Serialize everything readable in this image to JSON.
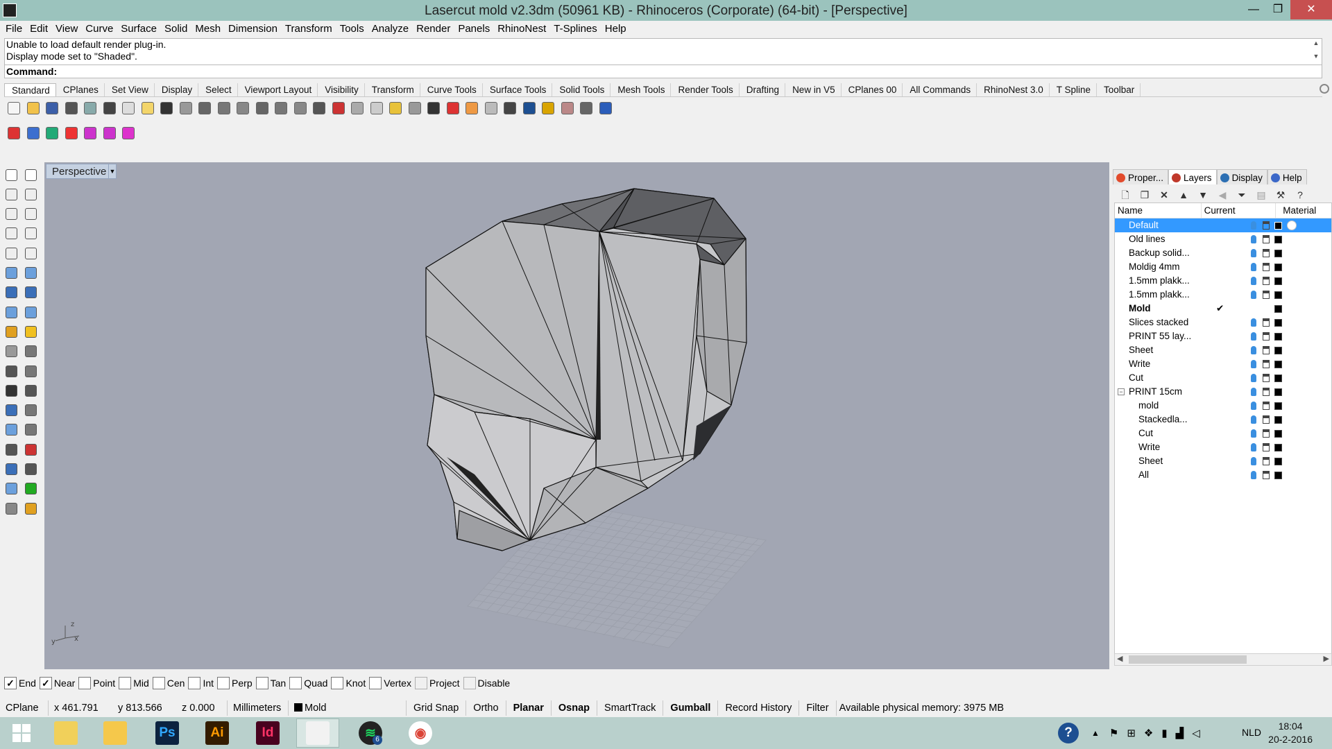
{
  "window": {
    "title": "Lasercut mold v2.3dm (50961 KB) - Rhinoceros (Corporate) (64-bit) - [Perspective]",
    "minimize": "—",
    "maximize": "❐",
    "close": "✕"
  },
  "menu": [
    "File",
    "Edit",
    "View",
    "Curve",
    "Surface",
    "Solid",
    "Mesh",
    "Dimension",
    "Transform",
    "Tools",
    "Analyze",
    "Render",
    "Panels",
    "RhinoNest",
    "T-Splines",
    "Help"
  ],
  "command": {
    "history": [
      "Unable to load default render plug-in.",
      "Display mode set to \"Shaded\"."
    ],
    "prompt": "Command:"
  },
  "toolbar_tabs": [
    "Standard",
    "CPlanes",
    "Set View",
    "Display",
    "Select",
    "Viewport Layout",
    "Visibility",
    "Transform",
    "Curve Tools",
    "Surface Tools",
    "Solid Tools",
    "Mesh Tools",
    "Render Tools",
    "Drafting",
    "New in V5",
    "CPlanes 00",
    "All Commands",
    "RhinoNest 3.0",
    "T Spline",
    "Toolbar"
  ],
  "standard_icons": [
    "new-file-icon",
    "open-icon",
    "save-icon",
    "print-icon",
    "import-icon",
    "cut-icon",
    "copy-icon",
    "paste-icon",
    "undo-icon",
    "pan-icon",
    "rotate-view-icon",
    "zoom-icon",
    "zoom-window-icon",
    "zoom-extents-icon",
    "zoom-selected-icon",
    "undo-view-icon",
    "four-viewports-icon",
    "car-icon",
    "hide-icon",
    "show-icon",
    "points-icon",
    "light-icon",
    "lock-icon",
    "layer-icon",
    "color-wheel-icon",
    "sphere-icon",
    "render-sphere-icon",
    "render-blue-icon",
    "dimension-icon",
    "gear-options-icon",
    "grid-snap-icon",
    "help-icon"
  ],
  "tspline_icons": [
    "gumball-icon",
    "sphere-frame-icon",
    "axes-icon",
    "manipulator-icon",
    "tspline-box-icon",
    "tspline-box-2-icon",
    "tspline-box-3-icon"
  ],
  "viewport": {
    "label": "Perspective",
    "axis_labels": {
      "x": "x",
      "y": "y",
      "z": "z"
    }
  },
  "panels": {
    "tabs": [
      "Proper...",
      "Layers",
      "Display",
      "Help"
    ],
    "tab_colors": [
      "#e24b2c",
      "#c0392b",
      "#2c6fb3",
      "#3a67c8"
    ],
    "columns": [
      "Name",
      "Current",
      "Material"
    ],
    "layers": [
      {
        "name": "Default",
        "selected": true
      },
      {
        "name": "Old lines"
      },
      {
        "name": "Backup solid..."
      },
      {
        "name": "Moldig 4mm"
      },
      {
        "name": "1.5mm plakk..."
      },
      {
        "name": "1.5mm plakk..."
      },
      {
        "name": "Mold",
        "current": true,
        "current_mark": "✔"
      },
      {
        "name": "Slices stacked"
      },
      {
        "name": "PRINT 55 lay..."
      },
      {
        "name": "Sheet"
      },
      {
        "name": "Write"
      },
      {
        "name": "Cut"
      },
      {
        "name": "PRINT 15cm",
        "expander": "−"
      },
      {
        "name": "mold",
        "child": true
      },
      {
        "name": "Stackedla...",
        "child": true
      },
      {
        "name": "Cut",
        "child": true
      },
      {
        "name": "Write",
        "child": true
      },
      {
        "name": "Sheet",
        "child": true
      },
      {
        "name": "All",
        "child": true
      }
    ]
  },
  "osnap": [
    {
      "label": "End",
      "checked": true
    },
    {
      "label": "Near",
      "checked": true
    },
    {
      "label": "Point",
      "checked": false
    },
    {
      "label": "Mid",
      "checked": false
    },
    {
      "label": "Cen",
      "checked": false
    },
    {
      "label": "Int",
      "checked": false
    },
    {
      "label": "Perp",
      "checked": false
    },
    {
      "label": "Tan",
      "checked": false
    },
    {
      "label": "Quad",
      "checked": false
    },
    {
      "label": "Knot",
      "checked": false
    },
    {
      "label": "Vertex",
      "checked": false
    },
    {
      "label": "Project",
      "checked": false,
      "disabled": true
    },
    {
      "label": "Disable",
      "checked": false,
      "disabled": true
    }
  ],
  "status": {
    "cplane": "CPlane",
    "x": "x 461.791",
    "y": "y 813.566",
    "z": "z 0.000",
    "units": "Millimeters",
    "layer": "Mold",
    "toggles": [
      {
        "label": "Grid Snap",
        "on": false
      },
      {
        "label": "Ortho",
        "on": false
      },
      {
        "label": "Planar",
        "on": true
      },
      {
        "label": "Osnap",
        "on": true
      },
      {
        "label": "SmartTrack",
        "on": false
      },
      {
        "label": "Gumball",
        "on": true
      },
      {
        "label": "Record History",
        "on": false
      },
      {
        "label": "Filter",
        "on": false
      }
    ],
    "memory": "Available physical memory: 3975 MB"
  },
  "taskbar": {
    "apps": [
      {
        "name": "windows-start-icon",
        "label": ""
      },
      {
        "name": "file-explorer-sticky-icon",
        "label": ""
      },
      {
        "name": "file-explorer-icon",
        "label": ""
      },
      {
        "name": "photoshop-icon",
        "label": "Ps"
      },
      {
        "name": "illustrator-icon",
        "label": "Ai"
      },
      {
        "name": "indesign-icon",
        "label": "Id"
      },
      {
        "name": "rhino-icon",
        "label": ""
      },
      {
        "name": "spotify-icon",
        "label": ""
      },
      {
        "name": "chrome-icon",
        "label": ""
      }
    ],
    "spotify_badge": "6",
    "lang": "NLD",
    "time": "18:04",
    "date": "20-2-2016"
  }
}
